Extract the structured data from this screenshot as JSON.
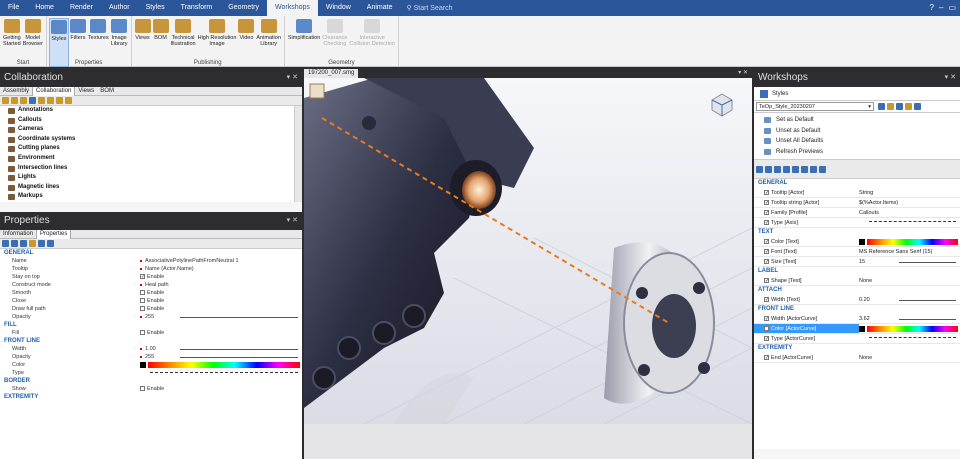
{
  "menu": {
    "tabs": [
      "File",
      "Home",
      "Render",
      "Author",
      "Styles",
      "Transform",
      "Geometry",
      "Workshops",
      "Window",
      "Animate"
    ],
    "active": "Workshops",
    "search_placeholder": "Start Search"
  },
  "ribbon": {
    "groups": [
      {
        "name": "Start",
        "buttons": [
          {
            "label": "Getting\nStarted"
          },
          {
            "label": "Model\nBrowser"
          }
        ]
      },
      {
        "name": "Properties",
        "buttons": [
          {
            "label": "Styles",
            "selected": true
          },
          {
            "label": "Filters"
          },
          {
            "label": "Textures"
          },
          {
            "label": "Image\nLibrary"
          }
        ]
      },
      {
        "name": "Publishing",
        "buttons": [
          {
            "label": "Views"
          },
          {
            "label": "BOM"
          },
          {
            "label": "Technical\nIllustration"
          },
          {
            "label": "High Resolution\nImage"
          },
          {
            "label": "Video"
          },
          {
            "label": "Animation\nLibrary"
          }
        ]
      },
      {
        "name": "Geometry",
        "buttons": [
          {
            "label": "Simplification"
          },
          {
            "label": "Clearance\nChecking",
            "disabled": true
          },
          {
            "label": "Interactive\nCollision Detection",
            "disabled": true
          }
        ]
      }
    ]
  },
  "collaboration": {
    "title": "Collaboration",
    "tabs": [
      "Assembly",
      "Collaboration",
      "Views",
      "BOM"
    ],
    "active_tab": "Collaboration",
    "items": [
      "Annotations",
      "Callouts",
      "Cameras",
      "Coordinate systems",
      "Cutting planes",
      "Environment",
      "Intersection lines",
      "Lights",
      "Magnetic lines",
      "Markups"
    ]
  },
  "properties": {
    "title": "Properties",
    "tabs": [
      "Information",
      "Properties"
    ],
    "active_tab": "Properties",
    "sections": [
      {
        "name": "GENERAL",
        "rows": [
          {
            "label": "Name",
            "value": "AssociativePolylinePathFromNeutral 1"
          },
          {
            "label": "Tooltip",
            "value": "Name (Actor.Name)"
          },
          {
            "label": "Stay on top",
            "value": "Enable"
          },
          {
            "label": "Construct mode",
            "value": "Heal path"
          },
          {
            "label": "Smooth",
            "value": "Enable"
          },
          {
            "label": "Close",
            "value": "Enable"
          },
          {
            "label": "Draw full path",
            "value": "Enable"
          },
          {
            "label": "Opacity",
            "value": "255"
          }
        ]
      },
      {
        "name": "FILL",
        "rows": [
          {
            "label": "Fill",
            "value": "Enable"
          }
        ]
      },
      {
        "name": "FRONT LINE",
        "rows": [
          {
            "label": "Width",
            "value": "1.00"
          },
          {
            "label": "Opacity",
            "value": "255"
          },
          {
            "label": "Color",
            "value": ""
          },
          {
            "label": "Type",
            "value": ""
          }
        ]
      },
      {
        "name": "BORDER",
        "rows": [
          {
            "label": "Show",
            "value": "Enable"
          }
        ]
      },
      {
        "name": "EXTREMITY",
        "rows": []
      }
    ]
  },
  "viewport": {
    "tab": "197200_007.smg"
  },
  "workshops": {
    "title": "Workshops",
    "header": "Styles",
    "style_name": "TeOp_Style_20230207",
    "actions": [
      "Set as Default",
      "Unset as Default",
      "Unset All Defaults",
      "Refresh Previews"
    ],
    "sections": [
      {
        "name": "GENERAL",
        "rows": [
          {
            "label": "Tooltip [Actor]",
            "value": "String"
          },
          {
            "label": "Tooltip string [Actor]",
            "value": "$(%Actor.Items)"
          },
          {
            "label": "Family [Profile]",
            "value": "Callouts"
          },
          {
            "label": "Type [Axis]",
            "value": ""
          }
        ]
      },
      {
        "name": "TEXT",
        "rows": [
          {
            "label": "Color [Text]",
            "value": ""
          },
          {
            "label": "Font [Text]",
            "value": "MS Reference Sans Serif (15)"
          },
          {
            "label": "Size [Text]",
            "value": "15"
          }
        ]
      },
      {
        "name": "LABEL",
        "rows": [
          {
            "label": "Shape [Text]",
            "value": "None"
          }
        ]
      },
      {
        "name": "ATTACH",
        "rows": [
          {
            "label": "Width [Text]",
            "value": "0.20"
          }
        ]
      },
      {
        "name": "FRONT LINE",
        "rows": [
          {
            "label": "Width [ActorCurve]",
            "value": "3.62"
          },
          {
            "label": "Color [ActorCurve]",
            "value": ""
          },
          {
            "label": "Type [ActorCurve]",
            "value": ""
          }
        ]
      },
      {
        "name": "EXTREMITY",
        "rows": [
          {
            "label": "End [ActorCurve]",
            "value": "None"
          }
        ]
      }
    ]
  },
  "colors": {
    "accent": "#2b579a",
    "dark": "#2d2d30",
    "section": "#1f5fb0",
    "path": "#e87b1c"
  }
}
